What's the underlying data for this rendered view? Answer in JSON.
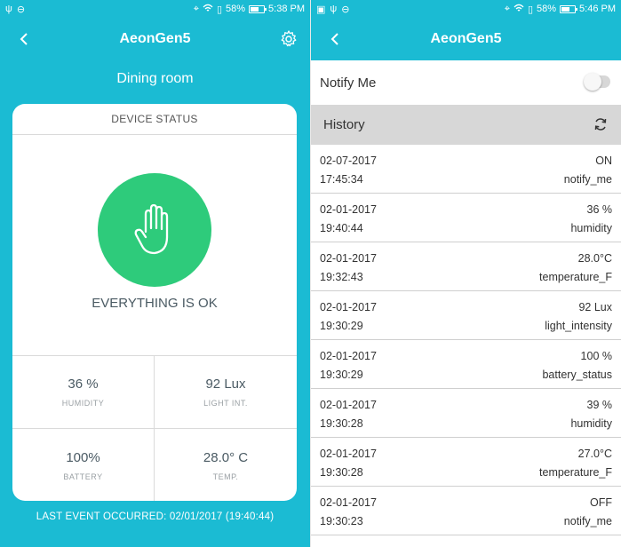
{
  "left": {
    "statusbar": {
      "battery": "58%",
      "time": "5:38 PM"
    },
    "appbar": {
      "title": "AeonGen5"
    },
    "room": "Dining room",
    "card": {
      "header": "DEVICE STATUS",
      "status": "EVERYTHING IS OK",
      "status_color": "#2ecb7b",
      "metrics": [
        {
          "value": "36 %",
          "label": "HUMIDITY"
        },
        {
          "value": "92 Lux",
          "label": "LIGHT INT."
        },
        {
          "value": "100%",
          "label": "BATTERY"
        },
        {
          "value": "28.0° C",
          "label": "TEMP."
        }
      ]
    },
    "last_event": "LAST EVENT OCCURRED: 02/01/2017 (19:40:44)"
  },
  "right": {
    "statusbar": {
      "battery": "58%",
      "time": "5:46 PM"
    },
    "appbar": {
      "title": "AeonGen5"
    },
    "notify_label": "Notify Me",
    "notify_on": false,
    "history_label": "History",
    "history": [
      {
        "date": "02-07-2017",
        "time": "17:45:34",
        "value": "ON",
        "type": "notify_me"
      },
      {
        "date": "02-01-2017",
        "time": "19:40:44",
        "value": "36 %",
        "type": "humidity"
      },
      {
        "date": "02-01-2017",
        "time": "19:32:43",
        "value": "28.0°C",
        "type": "temperature_F"
      },
      {
        "date": "02-01-2017",
        "time": "19:30:29",
        "value": "92 Lux",
        "type": "light_intensity"
      },
      {
        "date": "02-01-2017",
        "time": "19:30:29",
        "value": "100 %",
        "type": "battery_status"
      },
      {
        "date": "02-01-2017",
        "time": "19:30:28",
        "value": "39 %",
        "type": "humidity"
      },
      {
        "date": "02-01-2017",
        "time": "19:30:28",
        "value": "27.0°C",
        "type": "temperature_F"
      },
      {
        "date": "02-01-2017",
        "time": "19:30:23",
        "value": "OFF",
        "type": "notify_me"
      }
    ]
  },
  "colors": {
    "teal": "#1bbbd3",
    "green": "#2ecb7b",
    "history_bar": "#d7d7d7"
  }
}
